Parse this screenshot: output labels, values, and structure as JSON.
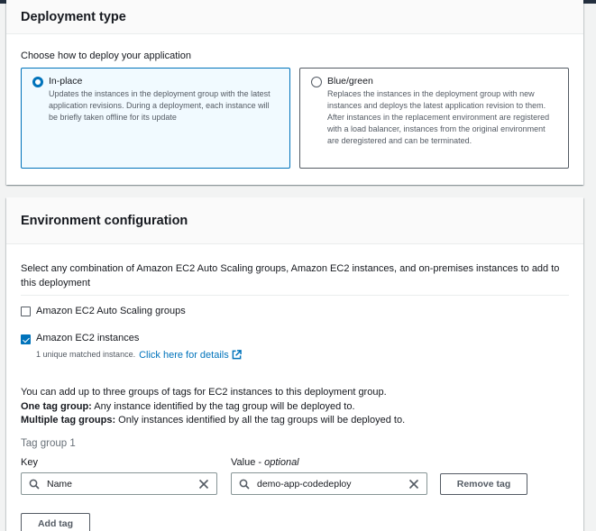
{
  "deployment_type": {
    "title": "Deployment type",
    "prompt": "Choose how to deploy your application",
    "options": [
      {
        "label": "In-place",
        "description": "Updates the instances in the deployment group with the latest application revisions. During a deployment, each instance will be briefly taken offline for its update",
        "selected": true
      },
      {
        "label": "Blue/green",
        "description": "Replaces the instances in the deployment group with new instances and deploys the latest application revision to them. After instances in the replacement environment are registered with a load balancer, instances from the original environment are deregistered and can be terminated.",
        "selected": false
      }
    ]
  },
  "environment": {
    "title": "Environment configuration",
    "intro": "Select any combination of Amazon EC2 Auto Scaling groups, Amazon EC2 instances, and on-premises instances to add to this deployment",
    "auto_scaling": {
      "label": "Amazon EC2 Auto Scaling groups",
      "checked": false
    },
    "ec2": {
      "label": "Amazon EC2 instances",
      "checked": true,
      "matched": "1 unique matched instance.",
      "details_link": "Click here for details"
    },
    "tag_info": {
      "line1": "You can add up to three groups of tags for EC2 instances to this deployment group.",
      "one_bold": "One tag group:",
      "one_rest": " Any instance identified by the tag group will be deployed to.",
      "multi_bold": "Multiple tag groups:",
      "multi_rest": " Only instances identified by all the tag groups will be deployed to."
    },
    "tag_group": {
      "title": "Tag group 1",
      "key_label": "Key",
      "value_label": "Value - ",
      "value_optional": "optional",
      "key_value": "Name",
      "value_value": "demo-app-codedeploy",
      "remove_label": "Remove tag",
      "add_label": "Add tag"
    }
  },
  "colors": {
    "accent": "#0073bb",
    "header_bar": "#232f3e",
    "background": "#f2f3f3"
  }
}
